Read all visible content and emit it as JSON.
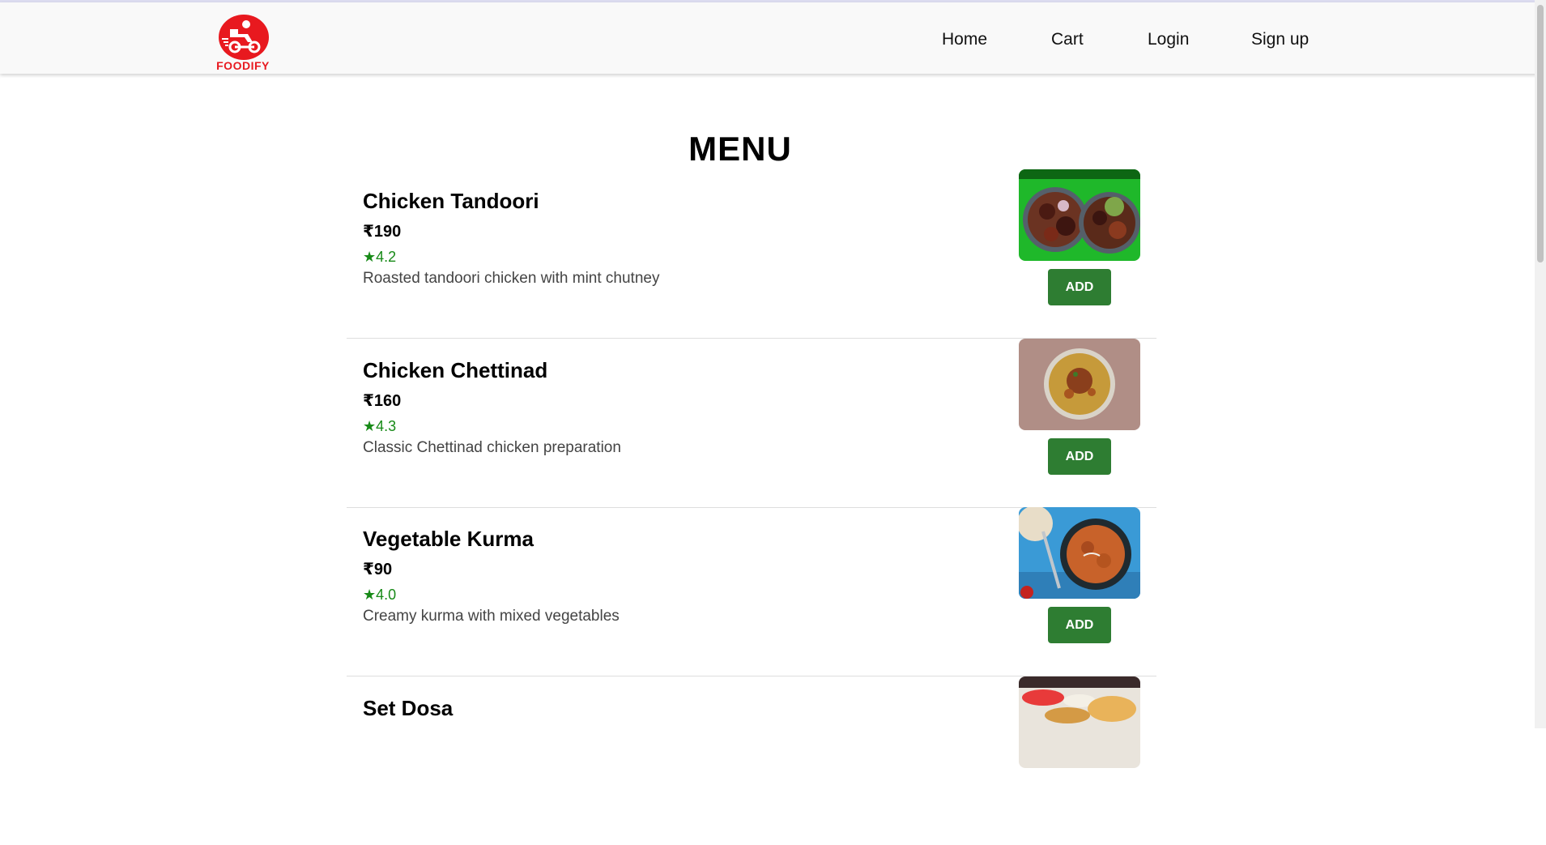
{
  "brand": {
    "name": "FOODIFY",
    "logo_icon": "delivery-rider-icon",
    "color": "#e8191f"
  },
  "nav": {
    "items": [
      {
        "label": "Home"
      },
      {
        "label": "Cart"
      },
      {
        "label": "Login"
      },
      {
        "label": "Sign up"
      }
    ]
  },
  "page": {
    "title": "MENU"
  },
  "menu": {
    "items": [
      {
        "name": "Chicken Tandoori",
        "price": "₹190",
        "rating": "★4.2",
        "description": "Roasted tandoori chicken with mint chutney",
        "button": "ADD",
        "image": "chicken-tandoori-photo"
      },
      {
        "name": "Chicken Chettinad",
        "price": "₹160",
        "rating": "★4.3",
        "description": "Classic Chettinad chicken preparation",
        "button": "ADD",
        "image": "chicken-chettinad-photo"
      },
      {
        "name": "Vegetable Kurma",
        "price": "₹90",
        "rating": "★4.0",
        "description": "Creamy kurma with mixed vegetables",
        "button": "ADD",
        "image": "vegetable-kurma-photo"
      },
      {
        "name": "Set Dosa",
        "image": "set-dosa-photo"
      }
    ]
  },
  "colors": {
    "add_button": "#2e7d32",
    "rating": "#178a17",
    "navbar_bg": "#f9f9f9"
  }
}
